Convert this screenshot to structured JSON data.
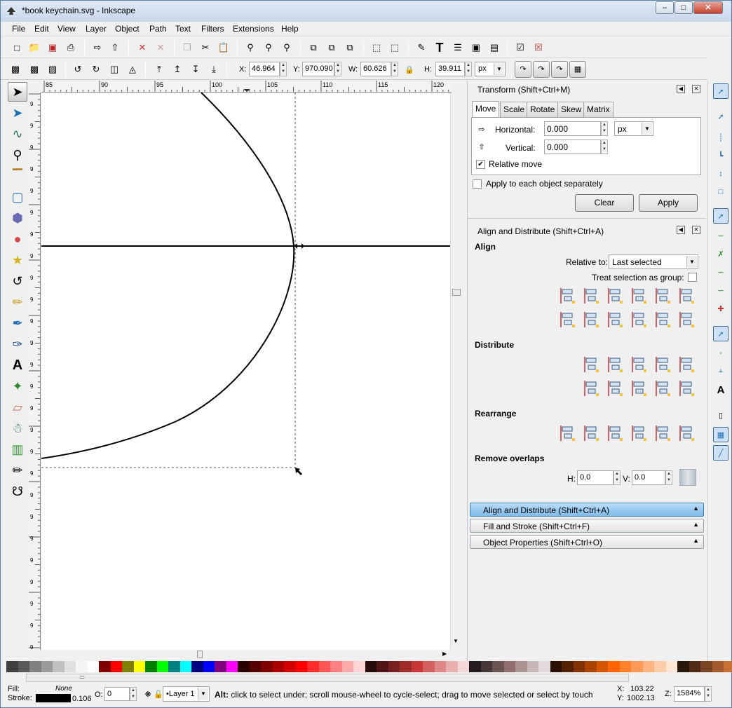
{
  "window": {
    "title": "*book keychain.svg - Inkscape",
    "minimize": "–",
    "maximize": "□",
    "close": "✕"
  },
  "menu": [
    "File",
    "Edit",
    "View",
    "Layer",
    "Object",
    "Path",
    "Text",
    "Filters",
    "Extensions",
    "Help"
  ],
  "controls": {
    "x_label": "X:",
    "x_value": "46.964",
    "y_label": "Y:",
    "y_value": "970.090",
    "w_label": "W:",
    "w_value": "60.626",
    "h_label": "H:",
    "h_value": "39.911",
    "unit": "px"
  },
  "rulers": {
    "h_ticks": [
      "85",
      "90",
      "95",
      "100",
      "105",
      "110",
      "115",
      "120"
    ],
    "v_ticks": [
      "9",
      "9",
      "9",
      "9",
      "9",
      "9",
      "9",
      "9",
      "9",
      "9",
      "9",
      "9",
      "9",
      "9",
      "9",
      "9",
      "9",
      "9",
      "9",
      "9",
      "9",
      "9",
      "9",
      "9",
      "9",
      "9"
    ]
  },
  "transform": {
    "title": "Transform (Shift+Ctrl+M)",
    "tabs": [
      "Move",
      "Scale",
      "Rotate",
      "Skew",
      "Matrix"
    ],
    "horizontal_label": "Horizontal:",
    "horizontal_value": "0.000",
    "unit": "px",
    "vertical_label": "Vertical:",
    "vertical_value": "0.000",
    "relative_move": "Relative move",
    "apply_each": "Apply to each object separately",
    "clear": "Clear",
    "apply": "Apply"
  },
  "align": {
    "title": "Align and Distribute (Shift+Ctrl+A)",
    "align_heading": "Align",
    "relative_to_label": "Relative to:",
    "relative_to_value": "Last selected",
    "treat_group": "Treat selection as group:",
    "distribute_heading": "Distribute",
    "rearrange_heading": "Rearrange",
    "overlaps_heading": "Remove overlaps",
    "h_label": "H:",
    "h_value": "0.0",
    "v_label": "V:",
    "v_value": "0.0"
  },
  "collapsed": [
    "Align and Distribute (Shift+Ctrl+A)",
    "Fill and Stroke (Shift+Ctrl+F)",
    "Object Properties (Shift+Ctrl+O)"
  ],
  "status": {
    "fill_label": "Fill:",
    "fill_value": "None",
    "stroke_label": "Stroke:",
    "stroke_width": "0.106",
    "opacity_label": "O:",
    "opacity_value": "0",
    "layer": "•Layer 1",
    "message_bold": "Alt:",
    "message": " click to select under; scroll mouse-wheel to cycle-select; drag to move selected or select by touch",
    "x_label": "X:",
    "x_value": "103.22",
    "y_label": "Y:",
    "y_value": "1002.13",
    "zoom_label": "Z:",
    "zoom_value": "1584%"
  },
  "palette": [
    "#404040",
    "#5a5a5a",
    "#808080",
    "#9b9b9b",
    "#c0c0c0",
    "#e0e0e0",
    "#f4f4f4",
    "#ffffff",
    "#800000",
    "#ff0000",
    "#808000",
    "#ffff00",
    "#008000",
    "#00ff00",
    "#008080",
    "#00ffff",
    "#000080",
    "#0000ff",
    "#800080",
    "#ff00ff",
    "#2b0000",
    "#550000",
    "#800000",
    "#aa0000",
    "#d40000",
    "#ff0000",
    "#ff2a2a",
    "#ff5555",
    "#ff8080",
    "#ffaaaa",
    "#ffd5d5",
    "#280b0b",
    "#501616",
    "#782121",
    "#a02c2c",
    "#c83737",
    "#d35f5f",
    "#de8787",
    "#e9afaf",
    "#f4d7d7",
    "#241c1c",
    "#483737",
    "#6c5353",
    "#916f6f",
    "#ac9393",
    "#c8b7b7",
    "#e3dbdb",
    "#2b1100",
    "#552200",
    "#803300",
    "#aa4400",
    "#d45500",
    "#ff6600",
    "#ff7f2a",
    "#ff9955",
    "#ffb380",
    "#ffccaa",
    "#ffe6d5",
    "#28170b",
    "#502d16",
    "#784421",
    "#a05a2c",
    "#c87137",
    "#d38d5f"
  ]
}
